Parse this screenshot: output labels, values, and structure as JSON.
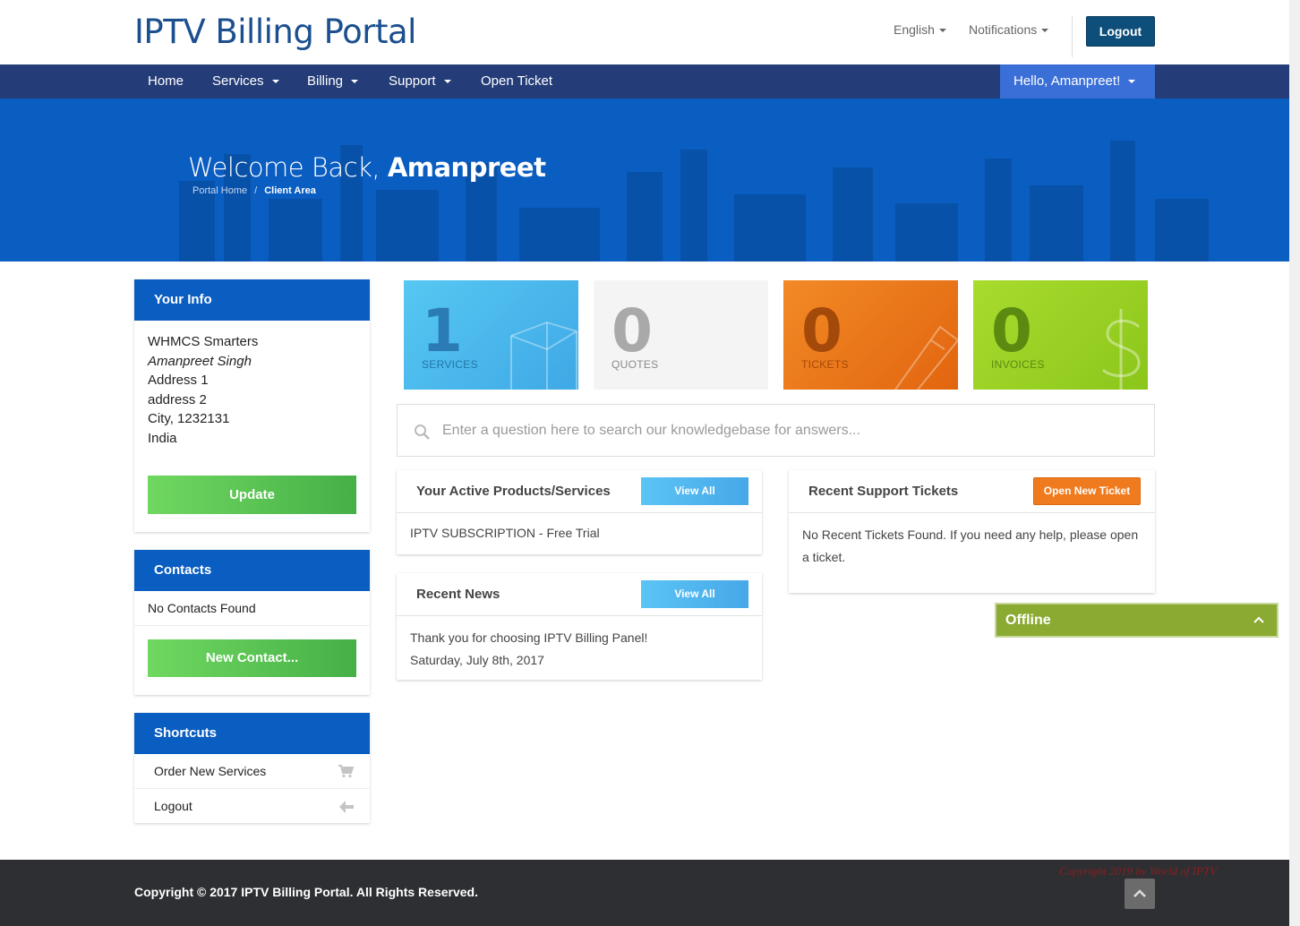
{
  "header": {
    "brand": "IPTV Billing Portal",
    "language": "English",
    "notifications": "Notifications",
    "logout": "Logout"
  },
  "nav": {
    "items": [
      "Home",
      "Services",
      "Billing",
      "Support",
      "Open Ticket"
    ],
    "user": "Hello, Amanpreet!"
  },
  "hero": {
    "welcome": "Welcome Back,",
    "name": "Amanpreet",
    "breadcrumb": [
      "Portal Home",
      "Client Area"
    ]
  },
  "your_info": {
    "title": "Your Info",
    "company": "WHMCS Smarters",
    "name": "Amanpreet Singh",
    "address1": "Address 1",
    "address2": "address 2",
    "city": "City, 1232131",
    "country": "India",
    "update": "Update"
  },
  "contacts": {
    "title": "Contacts",
    "empty": "No Contacts Found",
    "new": "New Contact..."
  },
  "shortcuts": {
    "title": "Shortcuts",
    "items": [
      "Order New Services",
      "Logout"
    ]
  },
  "stats": [
    {
      "value": "1",
      "label": "SERVICES",
      "color": "#4fc2ef"
    },
    {
      "value": "0",
      "label": "QUOTES",
      "color": "#f4f4f4"
    },
    {
      "value": "0",
      "label": "TICKETS",
      "color": "#ee7d1e"
    },
    {
      "value": "0",
      "label": "INVOICES",
      "color": "#9fd62a"
    }
  ],
  "kb_search": {
    "placeholder": "Enter a question here to search our knowledgebase for answers..."
  },
  "products": {
    "title": "Your Active Products/Services",
    "view_all": "View All",
    "item": "IPTV SUBSCRIPTION - Free Trial"
  },
  "news": {
    "title": "Recent News",
    "view_all": "View All",
    "headline": "Thank you for choosing IPTV Billing Panel!",
    "date": "Saturday, July 8th, 2017"
  },
  "tickets": {
    "title": "Recent Support Tickets",
    "open_new": "Open New Ticket",
    "empty": "No Recent Tickets Found. If you need any help, please open a ticket."
  },
  "chat": {
    "status": "Offline"
  },
  "footer": {
    "copyright": "Copyright © 2017 IPTV Billing Portal. All Rights Reserved.",
    "watermark": "Copyright 2019 by World of IPTV"
  }
}
